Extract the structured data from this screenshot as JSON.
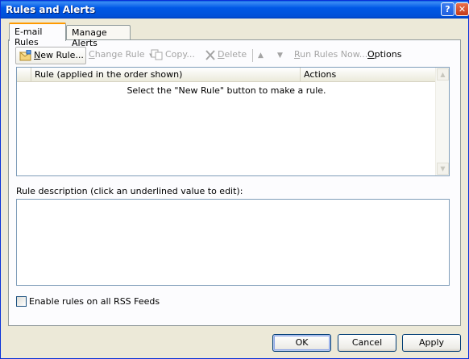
{
  "window": {
    "title": "Rules and Alerts",
    "help_glyph": "?",
    "close_glyph": "✕"
  },
  "tabs": [
    {
      "label": "E-mail Rules",
      "active": true
    },
    {
      "label": "Manage Alerts",
      "active": false
    }
  ],
  "toolbar": {
    "new_rule": {
      "prefix": "N",
      "rest": "ew Rule...",
      "icon": "new-rule-icon"
    },
    "change_rule": {
      "prefix": "C",
      "rest": "hange Rule",
      "icon": "dropdown-arrow-icon"
    },
    "copy": {
      "prefix": "",
      "rest": "Copy...",
      "icon": "copy-icon"
    },
    "delete": {
      "prefix": "D",
      "rest": "elete",
      "icon": "delete-x-icon"
    },
    "move_up_icon": "arrow-up-icon",
    "move_down_icon": "arrow-down-icon",
    "run_rules": {
      "prefix": "R",
      "rest": "un Rules Now...",
      "icon": ""
    },
    "options": {
      "prefix": "O",
      "rest": "ptions"
    }
  },
  "rule_list": {
    "columns": [
      "Rule (applied in the order shown)",
      "Actions"
    ],
    "empty_message": "Select the \"New Rule\" button to make a rule."
  },
  "description": {
    "label": "Rule description (click an underlined value to edit):"
  },
  "rss_checkbox": {
    "label": "Enable rules on all RSS Feeds",
    "checked": false
  },
  "buttons": {
    "ok": "OK",
    "cancel": "Cancel",
    "apply": "Apply"
  },
  "colors": {
    "titlebar": "#0058E6",
    "tab_accent": "#FF9A00",
    "disabled_text": "#A4A4A4",
    "dialog_bg": "#ECE9D8"
  }
}
